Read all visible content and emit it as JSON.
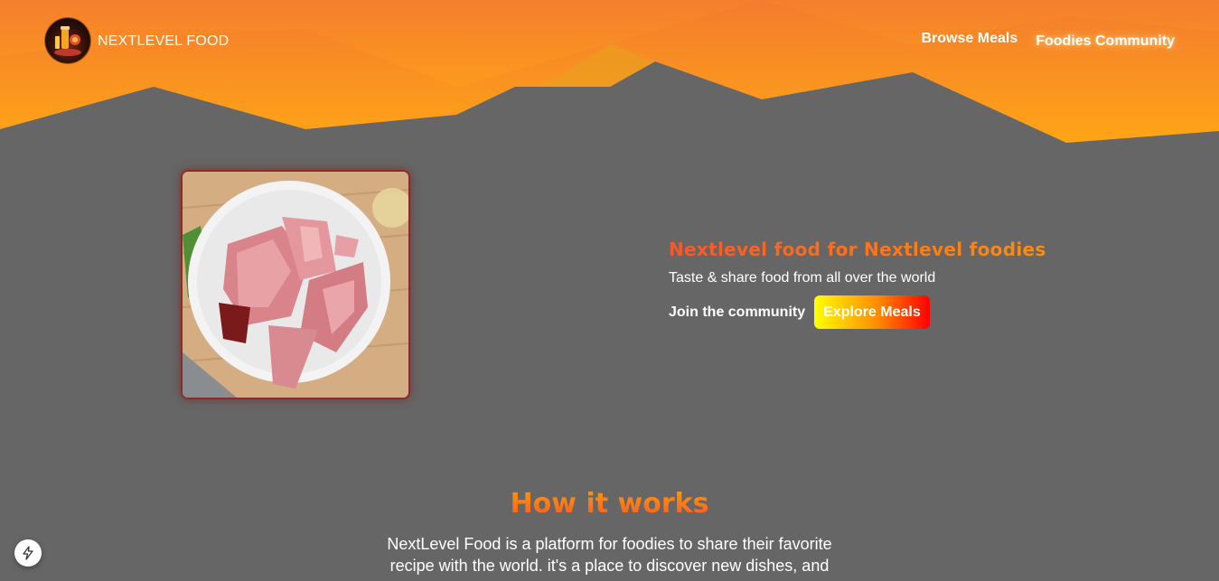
{
  "colors": {
    "page_background": "#666666",
    "header_orange": "#f9572a",
    "header_yellow": "#ff9b05",
    "image_border": "#8b2a2a"
  },
  "header": {
    "logo_text": "NEXTLEVEL FOOD",
    "logo_icon": "food-logo-icon",
    "nav": [
      {
        "label": "Browse Meals",
        "active": false
      },
      {
        "label": "Foodies Community",
        "active": true
      }
    ]
  },
  "hero": {
    "image_icon": "raw-meat-plate-photo",
    "title": "Nextlevel food for Nextlevel foodies",
    "subtitle": "Taste & share food from all over the world",
    "community_link": "Join the community",
    "explore_button": "Explore Meals"
  },
  "how_it_works": {
    "title": "How it works",
    "text": "NextLevel Food is a platform for foodies to share their favorite recipe with the world. it's a place to discover new dishes, and"
  },
  "dev_indicator": {
    "icon": "lightning-bolt-icon"
  }
}
